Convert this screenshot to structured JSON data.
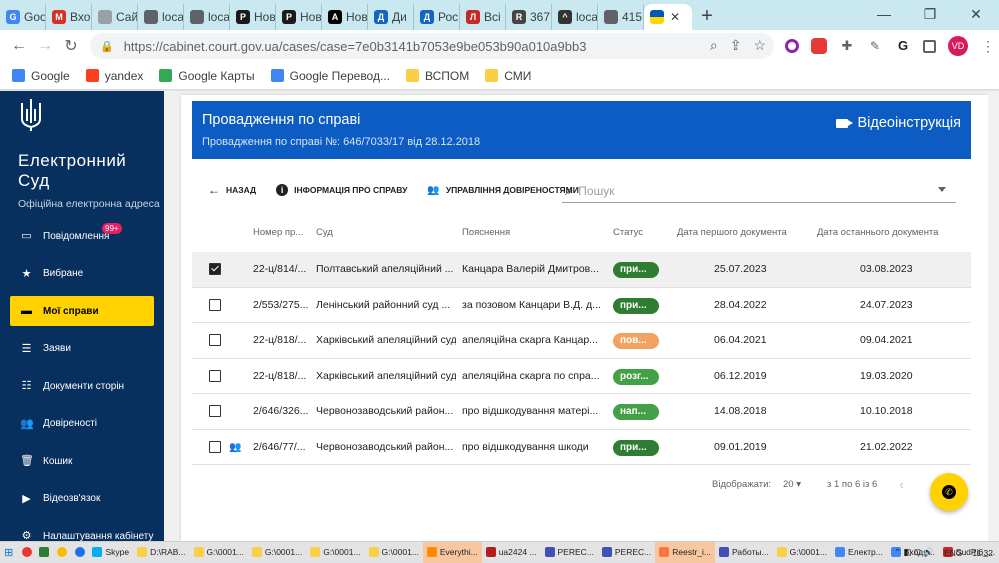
{
  "browser": {
    "tabs": [
      {
        "label": "Goo",
        "icon": "google-icon",
        "color": "#4285f4",
        "glyph": "G"
      },
      {
        "label": "Вхо",
        "icon": "gmail-icon",
        "color": "#d93025",
        "glyph": "M"
      },
      {
        "label": "Сайт не",
        "icon": "page-icon",
        "color": "#9aa0a6",
        "glyph": ""
      },
      {
        "label": "loca",
        "icon": "globe-icon",
        "color": "#5f6368",
        "glyph": ""
      },
      {
        "label": "loca",
        "icon": "globe-icon",
        "color": "#5f6368",
        "glyph": ""
      },
      {
        "label": "Нов",
        "icon": "pravda-icon",
        "color": "#1a1a1a",
        "glyph": "P"
      },
      {
        "label": "Нов",
        "icon": "pravda-icon",
        "color": "#1a1a1a",
        "glyph": "P"
      },
      {
        "label": "Нов",
        "icon": "a-icon",
        "color": "#000",
        "glyph": "A"
      },
      {
        "label": "Ди",
        "icon": "d-icon",
        "color": "#1565c0",
        "glyph": "Д"
      },
      {
        "label": "Рос",
        "icon": "d-icon",
        "color": "#1565c0",
        "glyph": "Д"
      },
      {
        "label": "Всі",
        "icon": "liga-icon",
        "color": "#c62828",
        "glyph": "Л"
      },
      {
        "label": "367",
        "icon": "raz-icon",
        "color": "#444",
        "glyph": "R"
      },
      {
        "label": "loca",
        "icon": "hat-icon",
        "color": "#333",
        "glyph": "^"
      },
      {
        "label": "415",
        "icon": "globe-icon",
        "color": "#5f6368",
        "glyph": ""
      }
    ],
    "active_tab_close": "✕",
    "new_tab": "+",
    "window_controls": [
      "—",
      "❐",
      "✕"
    ],
    "url": "https://cabinet.court.gov.ua/cases/case=7e0b3141b7053e9be053b90a010a9bb3",
    "profile_initials": "VD",
    "bookmarks": [
      {
        "label": "Google",
        "color": "#4285f4"
      },
      {
        "label": "yandex",
        "color": "#fc3f1d"
      },
      {
        "label": "Google Карты",
        "color": "#34a853"
      },
      {
        "label": "Google Перевод...",
        "color": "#4285f4"
      },
      {
        "label": "ВСПОМ",
        "color": "#f9cf48"
      },
      {
        "label": "СМИ",
        "color": "#f9cf48"
      }
    ]
  },
  "sidebar": {
    "brand": "Електронний Суд",
    "subtitle": "Офіційна електронна адреса",
    "items": [
      {
        "label": "Повідомлення",
        "icon": "chat-icon",
        "glyph": "▭",
        "badge": "99+",
        "active": false
      },
      {
        "label": "Вибране",
        "icon": "star-icon",
        "glyph": "★",
        "active": false
      },
      {
        "label": "Мої справи",
        "icon": "folder-icon",
        "glyph": "▬",
        "active": true
      },
      {
        "label": "Заяви",
        "icon": "list-icon",
        "glyph": "☰",
        "active": false
      },
      {
        "label": "Документи сторін",
        "icon": "documents-icon",
        "glyph": "☷",
        "active": false
      },
      {
        "label": "Довіреності",
        "icon": "people-icon",
        "glyph": "👥",
        "active": false
      },
      {
        "label": "Кошик",
        "icon": "trash-icon",
        "glyph": "🗑",
        "active": false
      },
      {
        "label": "Відеозв'язок",
        "icon": "video-icon",
        "glyph": "▶",
        "active": false
      },
      {
        "label": "Налаштування кабінету",
        "icon": "settings-icon",
        "glyph": "⚙",
        "active": false
      }
    ]
  },
  "header": {
    "title": "Провадження по справі",
    "subtitle": "Провадження по справі №: 646/7033/17 від 28.12.2018",
    "video_link": "Відеоінструкція"
  },
  "actions": {
    "back": "НАЗАД",
    "info": "ІНФОРМАЦІЯ ПРО СПРАВУ",
    "trust": "УПРАВЛІННЯ ДОВІРЕНОСТЯМИ"
  },
  "search": {
    "placeholder": "Пошук"
  },
  "table": {
    "columns": [
      "Номер пр...",
      "Суд",
      "Пояснення",
      "Статус",
      "Дата першого документа",
      "Дата останнього документа"
    ],
    "rows": [
      {
        "checked": true,
        "people": false,
        "number": "22-ц/814/...",
        "court": "Полтавський апеляційний ...",
        "note": "Канцара Валерій Дмитров...",
        "status": "при...",
        "status_color": "#2e7d32",
        "first": "25.07.2023",
        "last": "03.08.2023"
      },
      {
        "checked": false,
        "people": false,
        "number": "2/553/275...",
        "court": "Ленінський районний суд ...",
        "note": "за позовом Канцари В.Д. д...",
        "status": "при...",
        "status_color": "#2e7d32",
        "first": "28.04.2022",
        "last": "24.07.2023"
      },
      {
        "checked": false,
        "people": false,
        "number": "22-ц/818/...",
        "court": "Харківський апеляційний суд",
        "note": "апеляційна скарга Канцар...",
        "status": "пов...",
        "status_color": "#f4a261",
        "first": "06.04.2021",
        "last": "09.04.2021"
      },
      {
        "checked": false,
        "people": false,
        "number": "22-ц/818/...",
        "court": "Харківський апеляційний суд",
        "note": "апеляційна скарга по спра...",
        "status": "розг...",
        "status_color": "#43a047",
        "first": "06.12.2019",
        "last": "19.03.2020"
      },
      {
        "checked": false,
        "people": false,
        "number": "2/646/326...",
        "court": "Червонозаводський район...",
        "note": "про відшкодування матері...",
        "status": "нап...",
        "status_color": "#43a047",
        "first": "14.08.2018",
        "last": "10.10.2018"
      },
      {
        "checked": false,
        "people": true,
        "number": "2/646/77/...",
        "court": "Червонозаводський район...",
        "note": "про відшкодування шкоди",
        "status": "при...",
        "status_color": "#2e7d32",
        "first": "09.01.2019",
        "last": "21.02.2022"
      }
    ]
  },
  "pagination": {
    "label": "Відображати:",
    "per_page": "20",
    "range": "з 1 по 6 із 6",
    "prev": "‹"
  },
  "taskbar": {
    "items": [
      {
        "label": "Skype",
        "color": "#00aff0",
        "hl": false
      },
      {
        "label": "D:\\RAB...",
        "color": "#f9cf48",
        "hl": false
      },
      {
        "label": "G:\\0001...",
        "color": "#f9cf48",
        "hl": false
      },
      {
        "label": "G:\\0001...",
        "color": "#f9cf48",
        "hl": false
      },
      {
        "label": "G:\\0001...",
        "color": "#f9cf48",
        "hl": false
      },
      {
        "label": "G:\\0001...",
        "color": "#f9cf48",
        "hl": false
      },
      {
        "label": "Everythi...",
        "color": "#ff8a00",
        "hl": true
      },
      {
        "label": "ua2424 ...",
        "color": "#b71c1c",
        "hl": false
      },
      {
        "label": "PEREC...",
        "color": "#3f51b5",
        "hl": false
      },
      {
        "label": "PEREC...",
        "color": "#3f51b5",
        "hl": false
      },
      {
        "label": "Reestr_i...",
        "color": "#ff7043",
        "hl": true
      },
      {
        "label": "Работы...",
        "color": "#3f51b5",
        "hl": false
      },
      {
        "label": "G:\\0001...",
        "color": "#f9cf48",
        "hl": false
      },
      {
        "label": "Електр...",
        "color": "#4285f4",
        "hl": false
      },
      {
        "label": "Входя...",
        "color": "#4285f4",
        "hl": false
      },
      {
        "label": "SudPi6_...",
        "color": "#c62828",
        "hl": false
      }
    ],
    "lang": "ENG",
    "time": "11:32"
  }
}
